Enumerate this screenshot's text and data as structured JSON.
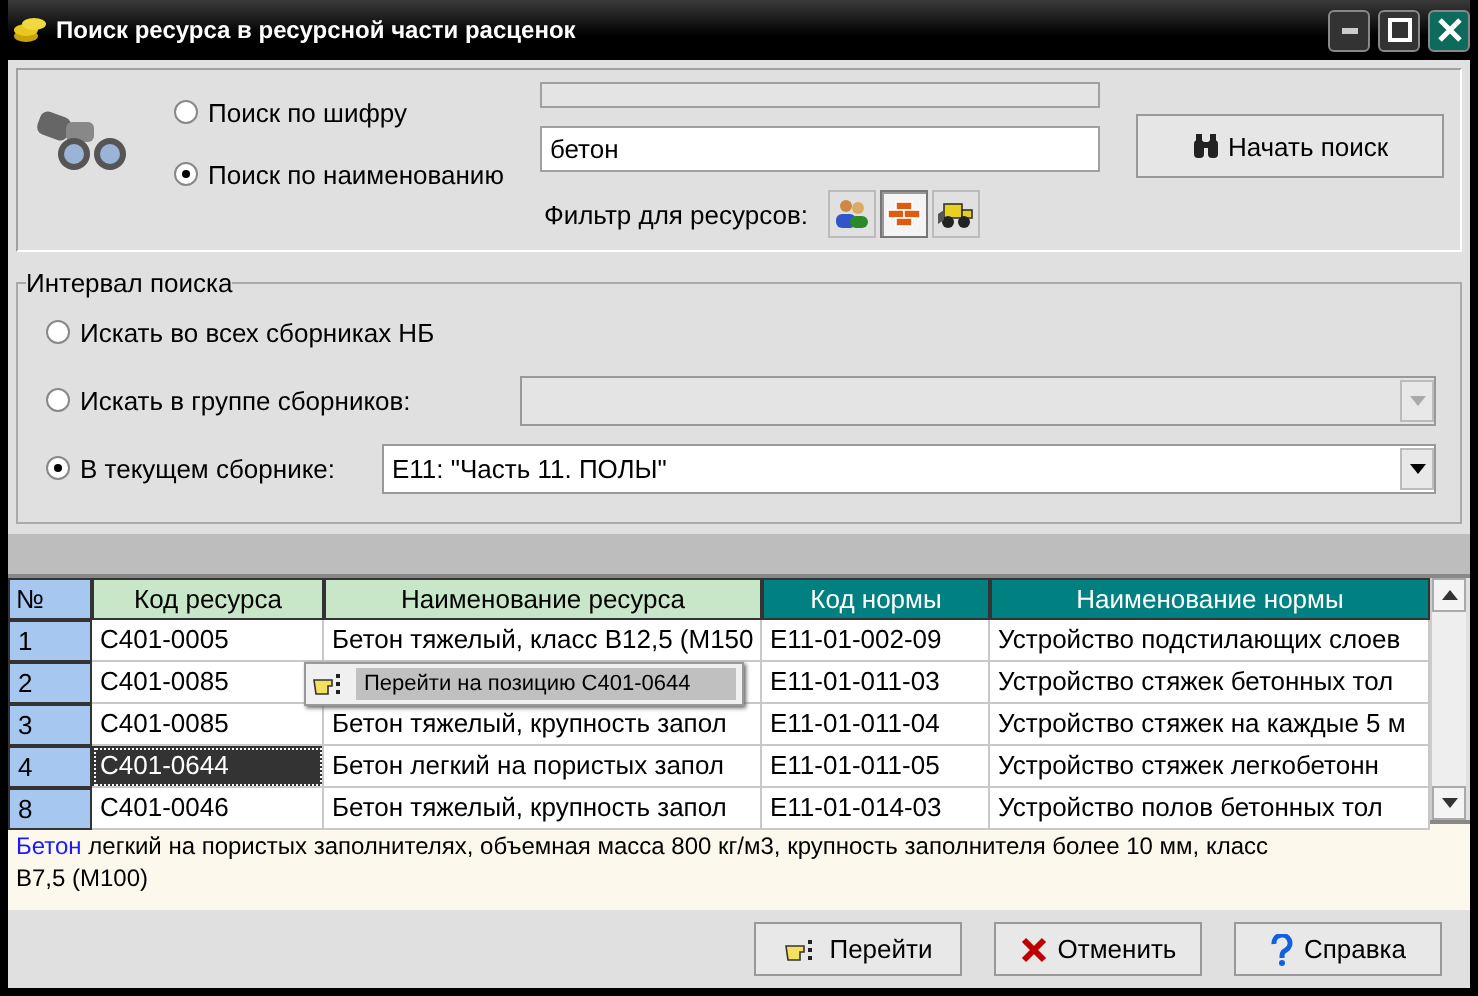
{
  "window": {
    "title": "Поиск ресурса в ресурсной части расценок"
  },
  "search": {
    "modes": [
      {
        "label": "Поиск по шифру",
        "selected": false,
        "disabled": true
      },
      {
        "label": "Поиск по наименованию",
        "selected": true,
        "value": "бетон",
        "disabled": false
      }
    ],
    "start_button": "Начать поиск",
    "filter_label": "Фильтр для ресурсов:",
    "filters": [
      {
        "kind": "people",
        "selected": false
      },
      {
        "kind": "bricks",
        "selected": true
      },
      {
        "kind": "machine",
        "selected": false
      }
    ]
  },
  "interval": {
    "title": "Интервал поиска",
    "options": [
      {
        "label": "Искать во всех сборниках НБ",
        "selected": false,
        "kind": "plain"
      },
      {
        "label": "Искать в группе сборников:",
        "selected": false,
        "kind": "combo",
        "disabled": true
      },
      {
        "label": "В текущем сборнике:",
        "selected": true,
        "kind": "combo",
        "value": "Е11: \"Часть 11. ПОЛЫ\"",
        "disabled": false
      }
    ]
  },
  "table": {
    "columns": [
      {
        "label": "№",
        "kind": "index"
      },
      {
        "label": "Код ресурса",
        "kind": "resource"
      },
      {
        "label": "Наименование ресурса",
        "kind": "resource"
      },
      {
        "label": "Код нормы",
        "kind": "norm"
      },
      {
        "label": "Наименование нормы",
        "kind": "norm"
      }
    ],
    "rows": [
      {
        "cells": [
          "1",
          "С401-0005",
          "Бетон тяжелый, класс В12,5 (М150",
          "Е11-01-002-09",
          "Устройство подстилающих слоев"
        ],
        "selected": false
      },
      {
        "cells": [
          "2",
          "С401-0085",
          null,
          "Е11-01-011-03",
          "Устройство стяжек бетонных тол"
        ],
        "selected": false
      },
      {
        "cells": [
          "3",
          "С401-0085",
          "Бетон тяжелый, крупность запол",
          "Е11-01-011-04",
          "Устройство стяжек на каждые 5 м"
        ],
        "selected": false
      },
      {
        "cells": [
          "4",
          "С401-0644",
          "Бетон легкий на пористых запол",
          "Е11-01-011-05",
          "Устройство стяжек легкобетонн"
        ],
        "selected": true
      },
      {
        "cells": [
          "8",
          "С401-0046",
          "Бетон тяжелый, крупность запол",
          "Е11-01-014-03",
          "Устройство полов бетонных тол"
        ],
        "selected": false
      }
    ]
  },
  "context_menu": {
    "item": "Перейти на позицию С401-0644"
  },
  "description": {
    "highlight": "Бетон",
    "text": " легкий на пористых заполнителях, объемная масса 800 кг/м3, крупность заполнителя более 10 мм, класс В7,5 (М100)"
  },
  "buttons": [
    {
      "kind": "go",
      "label": "Перейти"
    },
    {
      "kind": "cancel",
      "label": "Отменить"
    },
    {
      "kind": "help",
      "label": "Справка"
    }
  ]
}
